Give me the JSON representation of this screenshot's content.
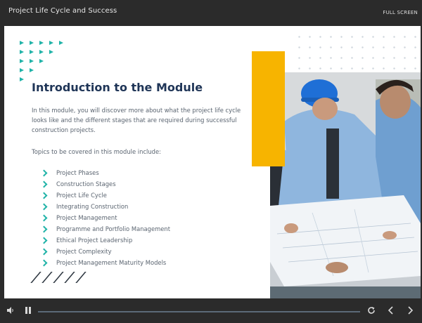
{
  "app": {
    "title": "Project Life Cycle and Success",
    "fullscreen_label": "FULL SCREEN"
  },
  "slide": {
    "heading": "Introduction to the Module",
    "intro": "In this module, you will discover more about what the project life cycle looks like and the different stages that are required during successful construction projects.",
    "topics_label": "Topics to be covered in this module include:",
    "topics": [
      "Project Phases",
      "Construction Stages",
      "Project Life Cycle",
      "Integrating Construction",
      "Project Management",
      "Programme and Portfolio Management",
      "Ethical Project Leadership",
      "Project Complexity",
      "Project Management Maturity Models"
    ],
    "accent_color": "#21b3a8",
    "yellow_color": "#f7b400",
    "heading_color": "#1f3557",
    "image_description_icon": "construction-team-photo"
  },
  "player": {
    "progress": 0.0,
    "icons": [
      "volume-icon",
      "pause-icon",
      "replay-icon",
      "prev-icon",
      "next-icon"
    ]
  }
}
